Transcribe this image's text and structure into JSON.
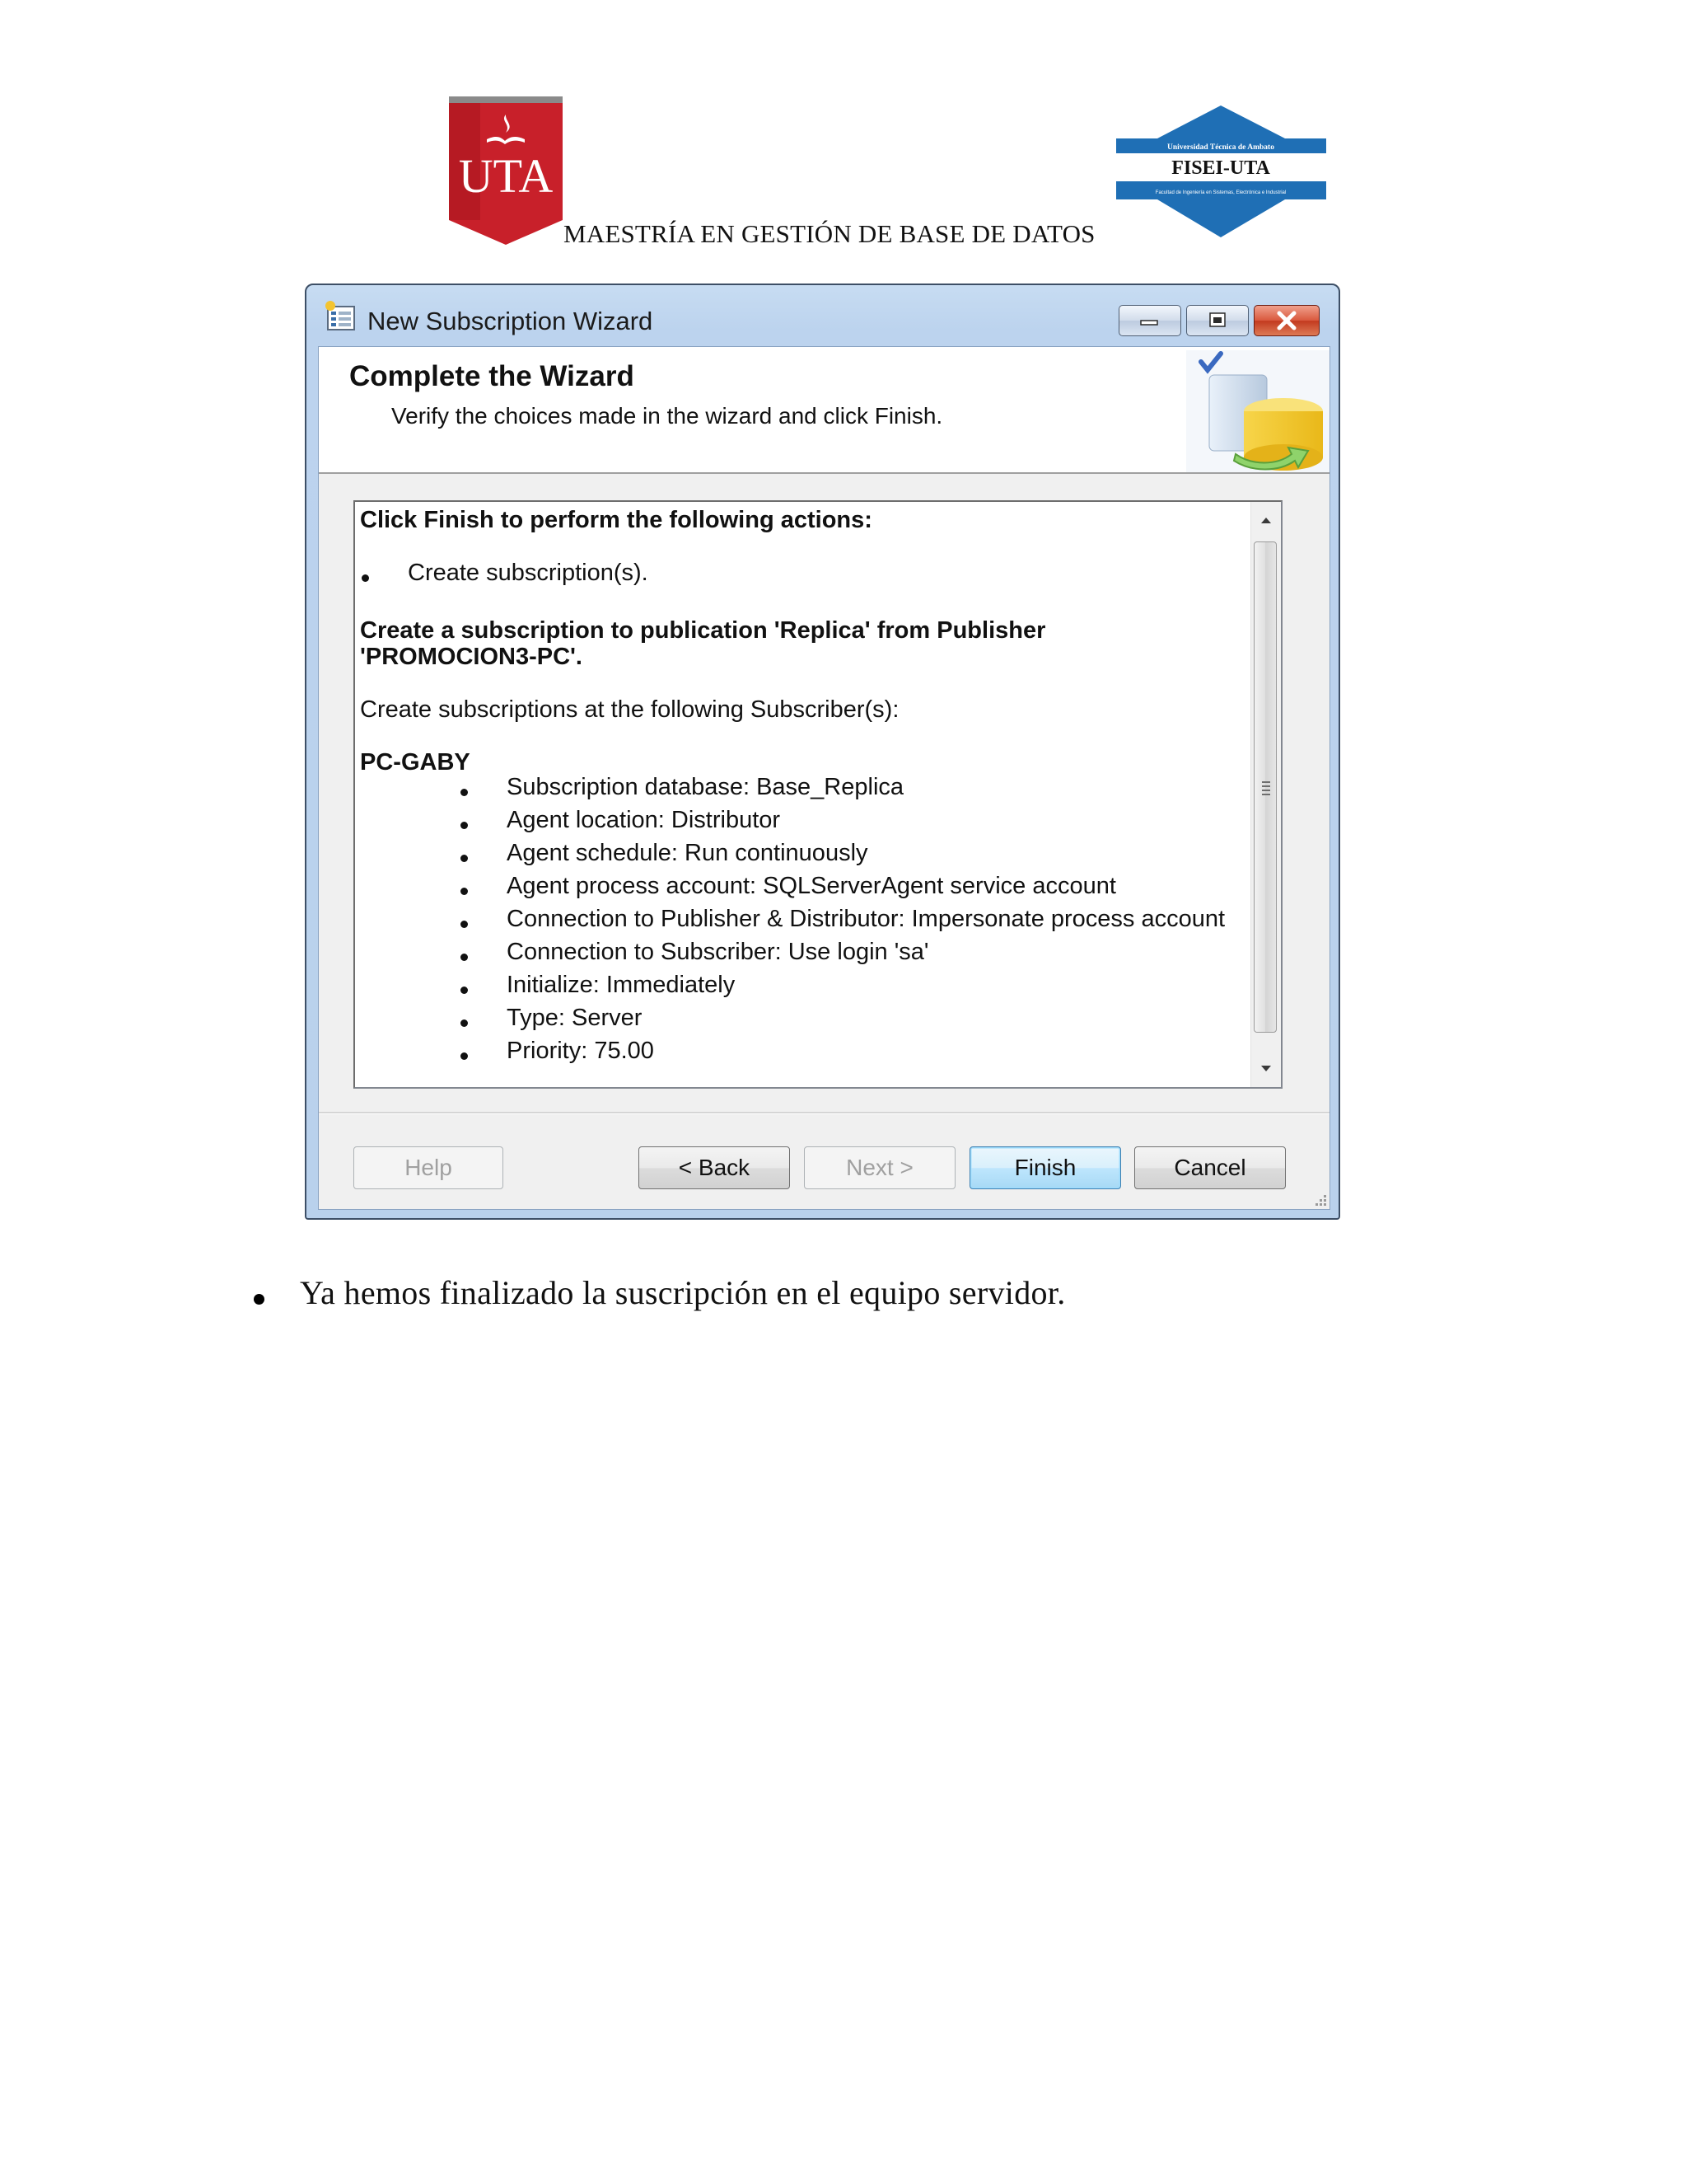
{
  "document": {
    "header_text": "MAESTRÍA EN GESTIÓN DE BASE DE DATOS",
    "uta_logo_text": "UTA",
    "fisei_logo_top": "Universidad Técnica de Ambato",
    "fisei_logo_main": "FISEI-UTA",
    "fisei_logo_bottom": "Facultad de Ingeniería en Sistemas, Electrónica e Industrial",
    "body_bullet": "Ya hemos finalizado la suscripción en el equipo servidor."
  },
  "window": {
    "title": "New Subscription Wizard",
    "controls": [
      "minimize",
      "maximize",
      "close"
    ]
  },
  "banner": {
    "title": "Complete the Wizard",
    "subtitle": "Verify the choices made in the wizard and click Finish."
  },
  "summary": {
    "heading": "Click Finish to perform the following actions:",
    "actions": [
      "Create subscription(s)."
    ],
    "publication_line1": "Create a subscription to publication 'Replica' from Publisher",
    "publication_line2": "'PROMOCION3-PC'.",
    "subscribers_intro": "Create subscriptions at the following Subscriber(s):",
    "subscriber_name": "PC-GABY",
    "subscriber_details": [
      "Subscription database: Base_Replica",
      "Agent location: Distributor",
      "Agent schedule: Run continuously",
      "Agent process account: SQLServerAgent service account",
      "Connection to Publisher & Distributor: Impersonate process account",
      "Connection to Subscriber: Use login 'sa'",
      "Initialize: Immediately",
      "Type: Server",
      "Priority: 75.00"
    ]
  },
  "buttons": {
    "help": "Help",
    "back": "< Back",
    "next": "Next >",
    "finish": "Finish",
    "cancel": "Cancel"
  },
  "colors": {
    "uta_red": "#c8202a",
    "fisei_blue": "#1f6fb5",
    "window_frame": "#bcd3ee",
    "close_button": "#c7432a",
    "default_button": "#3c7fb1"
  }
}
